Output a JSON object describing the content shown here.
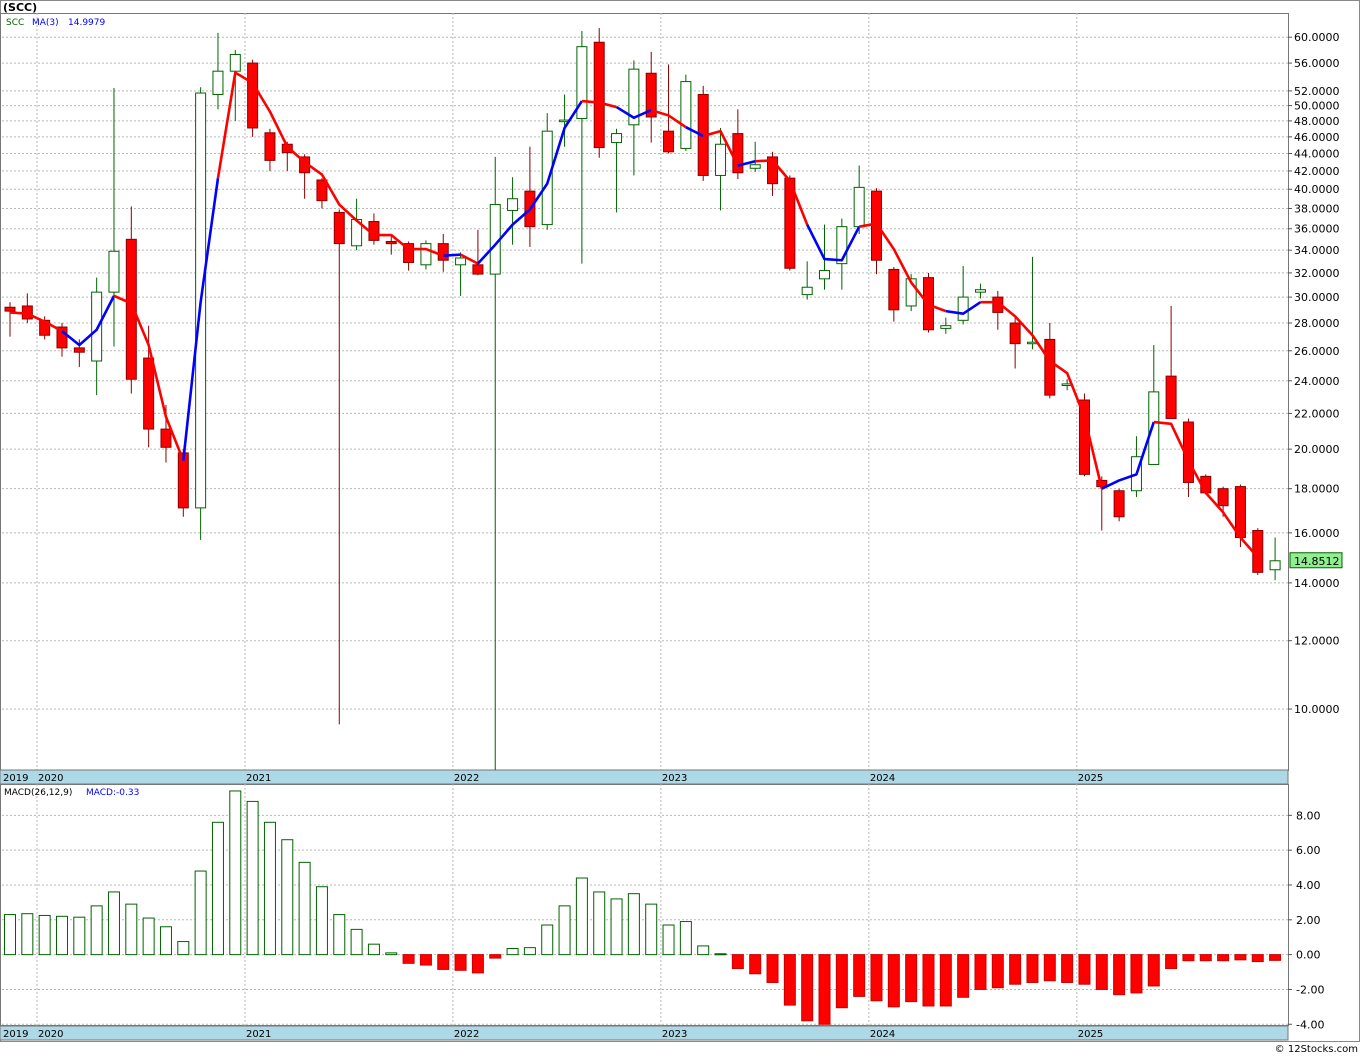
{
  "header": {
    "symbol": "(SCC)",
    "legend_symbol": "SCC",
    "legend_ma_label": "MA(3)",
    "legend_ma_value": "14.9979",
    "last_price_label": "14.8512"
  },
  "macd_panel": {
    "label": "MACD(26,12,9)",
    "value_label": "MACD:-0.33"
  },
  "footer": {
    "watermark": "© 12Stocks.com"
  },
  "colors": {
    "up": "#006400",
    "down": "#ff0000",
    "ma_up": "#0000ff",
    "ma_down": "#ff0000",
    "axis_band": "#add8e6",
    "grid": "#c8c8c8",
    "last_price_bg": "#90ee90"
  },
  "chart_data": [
    {
      "type": "candlestick",
      "title": "(SCC)",
      "interval": "monthly",
      "y_scale": "log",
      "ylim": [
        8.5,
        64
      ],
      "y_ticks": [
        "10.0000",
        "12.0000",
        "14.0000",
        "16.0000",
        "18.0000",
        "20.0000",
        "22.0000",
        "24.0000",
        "26.0000",
        "28.0000",
        "30.0000",
        "32.0000",
        "34.0000",
        "36.0000",
        "38.0000",
        "40.0000",
        "42.0000",
        "44.0000",
        "46.0000",
        "48.0000",
        "50.0000",
        "52.0000",
        "56.0000",
        "60.0000"
      ],
      "x_ticks": [
        "2019",
        "2020",
        "2021",
        "2022",
        "2023",
        "2024",
        "2025"
      ],
      "legend": [
        "SCC",
        "MA(3) 14.9979"
      ],
      "grid": true,
      "candles": [
        {
          "date": "2019-11",
          "o": 29.2,
          "h": 29.6,
          "l": 27.0,
          "c": 28.9
        },
        {
          "date": "2019-12",
          "o": 29.3,
          "h": 30.3,
          "l": 28.0,
          "c": 28.3
        },
        {
          "date": "2020-01",
          "o": 28.2,
          "h": 28.5,
          "l": 26.8,
          "c": 27.1
        },
        {
          "date": "2020-02",
          "o": 27.7,
          "h": 28.0,
          "l": 25.6,
          "c": 26.2
        },
        {
          "date": "2020-03",
          "o": 26.2,
          "h": 26.8,
          "l": 24.9,
          "c": 25.9
        },
        {
          "date": "2020-04",
          "o": 25.3,
          "h": 31.6,
          "l": 23.1,
          "c": 30.4
        },
        {
          "date": "2020-05",
          "o": 30.4,
          "h": 52.4,
          "l": 26.3,
          "c": 33.9
        },
        {
          "date": "2020-06",
          "o": 35.0,
          "h": 38.2,
          "l": 23.2,
          "c": 24.1
        },
        {
          "date": "2020-07",
          "o": 25.5,
          "h": 27.8,
          "l": 20.1,
          "c": 21.1
        },
        {
          "date": "2020-08",
          "o": 21.1,
          "h": 22.5,
          "l": 19.3,
          "c": 20.1
        },
        {
          "date": "2020-09",
          "o": 19.8,
          "h": 20.0,
          "l": 16.7,
          "c": 17.1
        },
        {
          "date": "2020-10",
          "o": 17.1,
          "h": 52.5,
          "l": 15.7,
          "c": 51.7
        },
        {
          "date": "2020-11",
          "o": 51.5,
          "h": 60.7,
          "l": 49.5,
          "c": 54.8
        },
        {
          "date": "2020-12",
          "o": 54.8,
          "h": 58.0,
          "l": 48.0,
          "c": 57.3
        },
        {
          "date": "2021-01",
          "o": 56.0,
          "h": 56.5,
          "l": 46.0,
          "c": 47.1
        },
        {
          "date": "2021-02",
          "o": 46.5,
          "h": 47.0,
          "l": 42.0,
          "c": 43.2
        },
        {
          "date": "2021-03",
          "o": 45.1,
          "h": 45.4,
          "l": 42.0,
          "c": 44.1
        },
        {
          "date": "2021-04",
          "o": 43.6,
          "h": 43.9,
          "l": 39.0,
          "c": 41.8
        },
        {
          "date": "2021-05",
          "o": 41.0,
          "h": 41.2,
          "l": 38.0,
          "c": 38.8
        },
        {
          "date": "2021-06",
          "o": 37.6,
          "h": 37.9,
          "l": 9.6,
          "c": 34.6
        },
        {
          "date": "2021-07",
          "o": 34.4,
          "h": 39.0,
          "l": 34.0,
          "c": 36.9
        },
        {
          "date": "2021-08",
          "o": 36.7,
          "h": 37.5,
          "l": 34.5,
          "c": 34.9
        },
        {
          "date": "2021-09",
          "o": 34.8,
          "h": 35.3,
          "l": 33.6,
          "c": 34.6
        },
        {
          "date": "2021-10",
          "o": 34.6,
          "h": 34.8,
          "l": 32.2,
          "c": 32.9
        },
        {
          "date": "2021-11",
          "o": 32.7,
          "h": 34.9,
          "l": 32.3,
          "c": 34.6
        },
        {
          "date": "2021-12",
          "o": 34.6,
          "h": 35.5,
          "l": 32.1,
          "c": 33.1
        },
        {
          "date": "2022-01",
          "o": 32.7,
          "h": 33.8,
          "l": 30.1,
          "c": 33.3
        },
        {
          "date": "2022-02",
          "o": 32.7,
          "h": 35.9,
          "l": 31.8,
          "c": 31.9
        },
        {
          "date": "2022-03",
          "o": 31.9,
          "h": 43.6,
          "l": 8.5,
          "c": 38.4
        },
        {
          "date": "2022-04",
          "o": 37.8,
          "h": 41.3,
          "l": 34.5,
          "c": 39.0
        },
        {
          "date": "2022-05",
          "o": 39.8,
          "h": 44.8,
          "l": 34.3,
          "c": 36.2
        },
        {
          "date": "2022-06",
          "o": 36.4,
          "h": 49.0,
          "l": 35.9,
          "c": 46.7
        },
        {
          "date": "2022-07",
          "o": 47.9,
          "h": 51.5,
          "l": 44.8,
          "c": 48.1
        },
        {
          "date": "2022-08",
          "o": 48.3,
          "h": 61.0,
          "l": 32.8,
          "c": 58.5
        },
        {
          "date": "2022-09",
          "o": 59.2,
          "h": 61.5,
          "l": 43.5,
          "c": 44.7
        },
        {
          "date": "2022-10",
          "o": 45.3,
          "h": 47.0,
          "l": 37.6,
          "c": 46.4
        },
        {
          "date": "2022-11",
          "o": 47.5,
          "h": 56.4,
          "l": 41.5,
          "c": 55.1
        },
        {
          "date": "2022-12",
          "o": 54.5,
          "h": 57.7,
          "l": 45.3,
          "c": 48.5
        },
        {
          "date": "2023-01",
          "o": 46.7,
          "h": 55.8,
          "l": 44.0,
          "c": 44.2
        },
        {
          "date": "2023-02",
          "o": 44.6,
          "h": 54.3,
          "l": 44.3,
          "c": 53.3
        },
        {
          "date": "2023-03",
          "o": 51.5,
          "h": 52.7,
          "l": 40.9,
          "c": 41.5
        },
        {
          "date": "2023-04",
          "o": 41.5,
          "h": 47.1,
          "l": 37.8,
          "c": 45.1
        },
        {
          "date": "2023-05",
          "o": 46.4,
          "h": 49.5,
          "l": 41.1,
          "c": 41.8
        },
        {
          "date": "2023-06",
          "o": 42.3,
          "h": 45.4,
          "l": 41.9,
          "c": 42.7
        },
        {
          "date": "2023-07",
          "o": 43.6,
          "h": 44.2,
          "l": 39.3,
          "c": 40.6
        },
        {
          "date": "2023-08",
          "o": 41.2,
          "h": 41.5,
          "l": 32.2,
          "c": 32.4
        },
        {
          "date": "2023-09",
          "o": 30.2,
          "h": 33.0,
          "l": 29.8,
          "c": 30.8
        },
        {
          "date": "2023-10",
          "o": 31.5,
          "h": 36.4,
          "l": 30.6,
          "c": 32.2
        },
        {
          "date": "2023-11",
          "o": 32.8,
          "h": 37.0,
          "l": 30.6,
          "c": 36.2
        },
        {
          "date": "2023-12",
          "o": 36.2,
          "h": 42.6,
          "l": 35.5,
          "c": 40.2
        },
        {
          "date": "2024-01",
          "o": 39.8,
          "h": 40.1,
          "l": 31.9,
          "c": 33.1
        },
        {
          "date": "2024-02",
          "o": 32.3,
          "h": 32.5,
          "l": 28.1,
          "c": 29.0
        },
        {
          "date": "2024-03",
          "o": 29.3,
          "h": 31.9,
          "l": 28.9,
          "c": 31.5
        },
        {
          "date": "2024-04",
          "o": 31.6,
          "h": 32.0,
          "l": 27.3,
          "c": 27.5
        },
        {
          "date": "2024-05",
          "o": 27.6,
          "h": 28.4,
          "l": 27.2,
          "c": 27.8
        },
        {
          "date": "2024-06",
          "o": 28.2,
          "h": 32.6,
          "l": 27.9,
          "c": 30.0
        },
        {
          "date": "2024-07",
          "o": 30.4,
          "h": 31.1,
          "l": 29.9,
          "c": 30.6
        },
        {
          "date": "2024-08",
          "o": 30.0,
          "h": 30.5,
          "l": 27.5,
          "c": 28.8
        },
        {
          "date": "2024-09",
          "o": 28.0,
          "h": 28.4,
          "l": 24.8,
          "c": 26.5
        },
        {
          "date": "2024-10",
          "o": 26.5,
          "h": 33.4,
          "l": 26.1,
          "c": 26.6
        },
        {
          "date": "2024-11",
          "o": 26.8,
          "h": 28.0,
          "l": 22.9,
          "c": 23.1
        },
        {
          "date": "2024-12",
          "o": 23.7,
          "h": 24.1,
          "l": 23.4,
          "c": 23.8
        },
        {
          "date": "2025-01",
          "o": 22.8,
          "h": 23.2,
          "l": 18.6,
          "c": 18.7
        },
        {
          "date": "2025-02",
          "o": 18.4,
          "h": 18.6,
          "l": 16.1,
          "c": 18.1
        },
        {
          "date": "2025-03",
          "o": 17.9,
          "h": 18.0,
          "l": 16.5,
          "c": 16.7
        },
        {
          "date": "2025-04",
          "o": 17.9,
          "h": 20.7,
          "l": 17.6,
          "c": 19.6
        },
        {
          "date": "2025-05",
          "o": 19.2,
          "h": 26.4,
          "l": 19.2,
          "c": 23.3
        },
        {
          "date": "2025-06",
          "o": 24.3,
          "h": 29.3,
          "l": 21.7,
          "c": 21.7
        },
        {
          "date": "2025-07",
          "o": 21.5,
          "h": 21.7,
          "l": 17.6,
          "c": 18.3
        },
        {
          "date": "2025-08",
          "o": 18.6,
          "h": 18.7,
          "l": 17.8,
          "c": 17.8
        },
        {
          "date": "2025-09",
          "o": 18.0,
          "h": 18.1,
          "l": 16.7,
          "c": 17.2
        },
        {
          "date": "2025-10",
          "o": 18.1,
          "h": 18.2,
          "l": 15.4,
          "c": 15.8
        },
        {
          "date": "2025-11",
          "o": 16.1,
          "h": 16.2,
          "l": 14.3,
          "c": 14.4
        },
        {
          "date": "2025-12",
          "o": 14.5,
          "h": 15.8,
          "l": 14.1,
          "c": 14.85
        }
      ],
      "ma3": [
        28.8,
        28.7,
        28.1,
        27.4,
        26.4,
        27.5,
        30.1,
        29.5,
        26.4,
        21.8,
        19.4,
        29.6,
        41.2,
        54.6,
        53.1,
        49.2,
        44.8,
        43.0,
        41.6,
        38.4,
        36.8,
        35.4,
        35.4,
        34.1,
        34.1,
        33.5,
        33.6,
        32.8,
        34.5,
        36.4,
        37.9,
        40.6,
        47.1,
        50.6,
        50.4,
        49.8,
        48.4,
        49.4,
        48.7,
        47.2,
        46.1,
        46.7,
        42.6,
        43.1,
        43.2,
        40.9,
        36.4,
        33.2,
        33.1,
        36.2,
        36.5,
        34.1,
        31.2,
        29.4,
        28.9,
        28.7,
        29.6,
        29.6,
        28.5,
        27.1,
        25.3,
        24.5,
        21.8,
        18.0,
        18.4,
        18.7,
        21.5,
        21.4,
        19.4,
        17.8,
        16.9,
        15.8,
        14.99
      ],
      "ma3_color_runs": [
        {
          "from": "2019-11",
          "to": "2020-02",
          "color": "red"
        },
        {
          "from": "2020-02",
          "to": "2020-05",
          "color": "blue"
        },
        {
          "from": "2020-05",
          "to": "2020-09",
          "color": "red"
        },
        {
          "from": "2020-09",
          "to": "2020-11",
          "color": "blue"
        },
        {
          "from": "2020-11",
          "to": "2021-12",
          "color": "red"
        },
        {
          "from": "2021-12",
          "to": "2022-01",
          "color": "blue"
        },
        {
          "from": "2022-01",
          "to": "2022-02",
          "color": "red"
        },
        {
          "from": "2022-02",
          "to": "2022-08",
          "color": "blue"
        },
        {
          "from": "2022-08",
          "to": "2022-10",
          "color": "red"
        },
        {
          "from": "2022-10",
          "to": "2022-12",
          "color": "blue"
        },
        {
          "from": "2022-12",
          "to": "2023-02",
          "color": "red"
        },
        {
          "from": "2023-02",
          "to": "2023-03",
          "color": "blue"
        },
        {
          "from": "2023-03",
          "to": "2023-05",
          "color": "red"
        },
        {
          "from": "2023-05",
          "to": "2023-06",
          "color": "blue"
        },
        {
          "from": "2023-06",
          "to": "2023-09",
          "color": "red"
        },
        {
          "from": "2023-09",
          "to": "2023-12",
          "color": "blue"
        },
        {
          "from": "2023-12",
          "to": "2024-05",
          "color": "red"
        },
        {
          "from": "2024-05",
          "to": "2024-07",
          "color": "blue"
        },
        {
          "from": "2024-07",
          "to": "2025-02",
          "color": "red"
        },
        {
          "from": "2025-02",
          "to": "2025-05",
          "color": "blue"
        },
        {
          "from": "2025-05",
          "to": "2025-12",
          "color": "red"
        }
      ],
      "last_value": 14.8512
    },
    {
      "type": "bar",
      "title": "MACD(26,12,9)",
      "series_label": "MACD:-0.33",
      "ylim": [
        -4.1,
        9.8
      ],
      "y_ticks": [
        "8.00",
        "6.00",
        "4.00",
        "2.00",
        "0.00",
        "-2.00",
        "-4.00"
      ],
      "x_ticks": [
        "2019",
        "2020",
        "2021",
        "2022",
        "2023",
        "2024",
        "2025"
      ],
      "grid": true,
      "values": [
        2.3,
        2.35,
        2.25,
        2.2,
        2.15,
        2.8,
        3.6,
        2.9,
        2.1,
        1.6,
        0.75,
        4.8,
        7.6,
        9.4,
        8.8,
        7.6,
        6.6,
        5.3,
        3.9,
        2.3,
        1.45,
        0.6,
        0.1,
        -0.5,
        -0.6,
        -0.85,
        -0.9,
        -1.05,
        -0.2,
        0.35,
        0.4,
        1.7,
        2.8,
        4.4,
        3.6,
        3.2,
        3.5,
        2.9,
        1.7,
        1.9,
        0.5,
        0.05,
        -0.8,
        -1.1,
        -1.6,
        -2.9,
        -3.8,
        -4.0,
        -3.05,
        -2.4,
        -2.65,
        -3.0,
        -2.7,
        -2.95,
        -2.95,
        -2.45,
        -2.0,
        -1.9,
        -1.7,
        -1.6,
        -1.5,
        -1.6,
        -1.7,
        -2.0,
        -2.3,
        -2.2,
        -1.8,
        -0.8,
        -0.35,
        -0.35,
        -0.35,
        -0.3,
        -0.4,
        -0.33
      ]
    }
  ]
}
